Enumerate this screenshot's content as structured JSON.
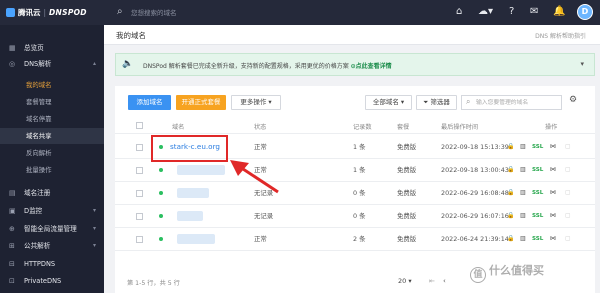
{
  "topbar": {
    "logo_brand": "腾讯云",
    "logo_product": "DNSPOD",
    "search_placeholder": "您想搜索的域名"
  },
  "sidebar": {
    "items": [
      {
        "label": "总览页"
      },
      {
        "label": "DNS解析"
      },
      {
        "label": "我的域名"
      },
      {
        "label": "套餐管理"
      },
      {
        "label": "域名停靠"
      },
      {
        "label": "域名共享"
      },
      {
        "label": "反向解析"
      },
      {
        "label": "批量操作"
      },
      {
        "label": "域名注册"
      },
      {
        "label": "D监控"
      },
      {
        "label": "智能全局流量管理"
      },
      {
        "label": "公共解析"
      },
      {
        "label": "HTTPDNS"
      },
      {
        "label": "PrivateDNS"
      }
    ]
  },
  "breadcrumb": {
    "title": "我的域名",
    "help": "DNS 解析帮助指引"
  },
  "banner": {
    "text": "DNSPod 解析套餐已完成全新升级，支持新的配置规格，采用更优的价格方案",
    "link": "点此查看详情"
  },
  "toolbar": {
    "add": "添加域名",
    "upgrade": "开通正式套餐",
    "more": "更多操作",
    "all_domains": "全部域名",
    "filter": "筛选器",
    "search_placeholder": "输入您要管理的域名"
  },
  "table": {
    "headers": {
      "domain": "域名",
      "status": "状态",
      "records": "记录数",
      "plan": "套餐",
      "updated": "最后操作时间",
      "ops": "操作"
    },
    "rows": [
      {
        "domain": "stark-c.eu.org",
        "status": "正常",
        "records": "1 条",
        "plan": "免费版",
        "updated": "2022-09-18 15:13:39"
      },
      {
        "domain": "",
        "status": "正常",
        "records": "1 条",
        "plan": "免费版",
        "updated": "2022-09-18 13:00:43"
      },
      {
        "domain": "",
        "status": "无记录",
        "records": "0 条",
        "plan": "免费版",
        "updated": "2022-06-29 16:08:48"
      },
      {
        "domain": "",
        "status": "无记录",
        "records": "0 条",
        "plan": "免费版",
        "updated": "2022-06-29 16:07:16"
      },
      {
        "domain": "",
        "status": "正常",
        "records": "2 条",
        "plan": "免费版",
        "updated": "2022-06-24 21:39:14"
      }
    ],
    "ssl_label": "SSL"
  },
  "footer": {
    "summary": "第 1-5 行，共 5 行",
    "page_size": "20"
  },
  "watermark": {
    "badge": "值",
    "text": "什么值得买"
  },
  "colors": {
    "topbar": "#25293a",
    "sidebar": "#1e2232",
    "accent_blue": "#3a92f2",
    "accent_orange": "#f7a320",
    "status_green": "#2bbf60",
    "annotation_red": "#e02828"
  }
}
